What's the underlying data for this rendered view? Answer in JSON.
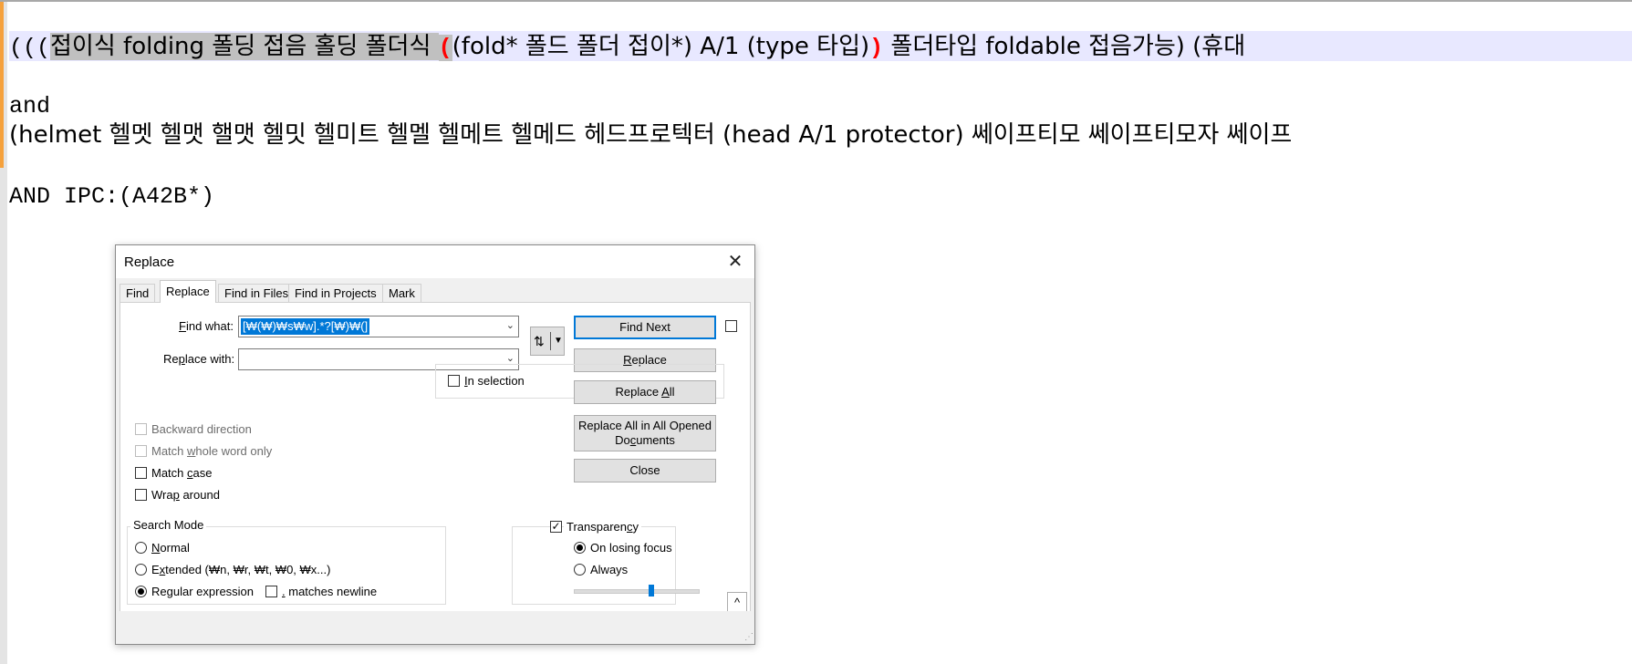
{
  "editor": {
    "line1": {
      "prefix": "(((",
      "selected_text": "접이식 folding 폴딩 접음 홀딩 폴더식 ",
      "open_brace": "(",
      "middle": "(fold* 폴드 폴더 접이*) A/1 (type 타입)",
      "close_brace": ")",
      "rest": " 폴더타입 foldable 접음가능) (휴대"
    },
    "line2": "and",
    "line3": "(helmet 헬멧 헬맷 핼맷 헬밋 헬미트 헬멜 헬메트 헬메드 헤드프로텍터 (head A/1 protector) 쎄이프티모 쎄이프티모자 쎄이프",
    "line4": "AND IPC:(A42B*)"
  },
  "dialog": {
    "title": "Replace",
    "close_glyph": "✕",
    "tabs": [
      {
        "label": "Find",
        "active": false
      },
      {
        "label": "Replace",
        "active": true
      },
      {
        "label": "Find in Files",
        "active": false
      },
      {
        "label": "Find in Projects",
        "active": false
      },
      {
        "label": "Mark",
        "active": false
      }
    ],
    "find_what": {
      "label_pre": "",
      "label_u": "F",
      "label_post": "ind what:",
      "value": "[₩(₩)₩s₩w].*?[₩)₩(]"
    },
    "replace_with": {
      "label_pre": "Re",
      "label_u": "p",
      "label_post": "lace with:",
      "value": ""
    },
    "swap_glyph": "⇅",
    "buttons": {
      "find_next": "Find Next",
      "replace_pre": "",
      "replace_u": "R",
      "replace_post": "eplace",
      "replace_all_pre": "Replace ",
      "replace_all_u": "A",
      "replace_all_post": "ll",
      "replace_all_opened_pre": "Replace All in All Opened Do",
      "replace_all_opened_u": "c",
      "replace_all_opened_post": "uments",
      "close": "Close"
    },
    "in_selection": {
      "label_pre": "",
      "label_u": "I",
      "label_post": "n selection",
      "checked": false
    },
    "options": {
      "backward": {
        "label": "Backward direction",
        "checked": false,
        "disabled": true
      },
      "whole_word_pre": "Match ",
      "whole_word_u": "w",
      "whole_word_post": "hole word only",
      "match_case_pre": "Match ",
      "match_case_u": "c",
      "match_case_post": "ase",
      "wrap_pre": "Wra",
      "wrap_u": "p",
      "wrap_post": " around"
    },
    "search_mode": {
      "title": "Search Mode",
      "normal_u": "N",
      "normal_post": "ormal",
      "extended_pre": "E",
      "extended_u": "x",
      "extended_post": "tended (₩n, ₩r, ₩t, ₩0, ₩x...)",
      "regex_pre": "Re",
      "regex_u": "g",
      "regex_post": "ular expression",
      "selected": "regex",
      "dot_u": ".",
      "dot_post": " matches newline",
      "dot_checked": false
    },
    "transparency": {
      "label_pre": "Transparen",
      "label_u": "c",
      "label_post": "y",
      "checked": true,
      "on_losing_focus": "On losing focus",
      "always": "Always",
      "selected": "on_losing_focus",
      "level": 0.62
    },
    "collapse_glyph": "^",
    "grip_glyph": "⋰"
  }
}
